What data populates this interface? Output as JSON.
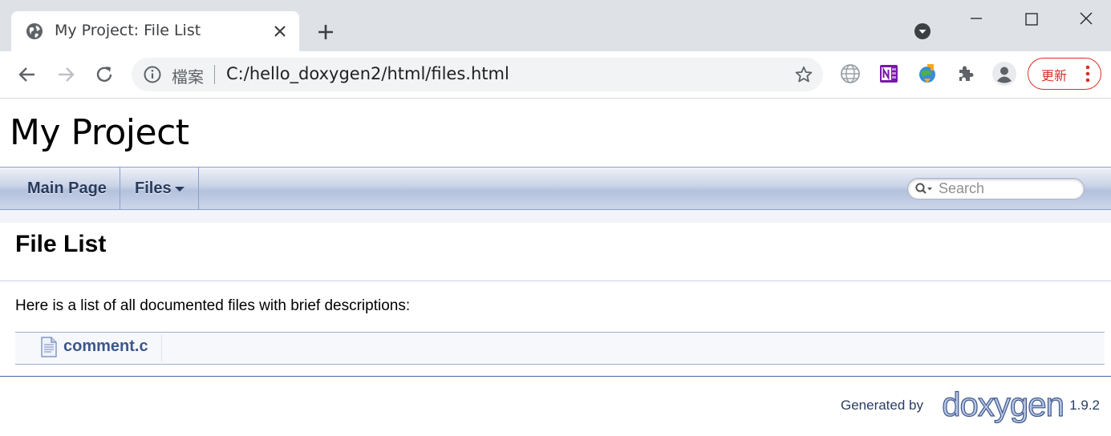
{
  "browser": {
    "tab_title": "My Project: File List",
    "address_label": "檔案",
    "url": "C:/hello_doxygen2/html/files.html",
    "update_label": "更新",
    "icons": [
      "globe-icon",
      "close-icon",
      "plus-icon",
      "dropdown-icon",
      "minimize-icon",
      "maximize-icon",
      "close-window-icon",
      "back-icon",
      "forward-icon",
      "reload-icon",
      "info-icon",
      "star-icon",
      "translate-icon",
      "onenote-icon",
      "download-manager-icon",
      "extensions-icon",
      "profile-icon",
      "kebab-menu-icon"
    ]
  },
  "page": {
    "project_title": "My Project",
    "nav": {
      "main_page": "Main Page",
      "files": "Files",
      "search_placeholder": "Search"
    },
    "heading": "File List",
    "intro": "Here is a list of all documented files with brief descriptions:",
    "files": [
      {
        "name": "comment.c",
        "description": ""
      }
    ],
    "footer": {
      "generated_by": "Generated by",
      "logo_text": "doxygen",
      "version": "1.9.2"
    }
  },
  "colors": {
    "link": "#3d578c",
    "nav_text": "#283a5d",
    "update_red": "#d93025"
  }
}
